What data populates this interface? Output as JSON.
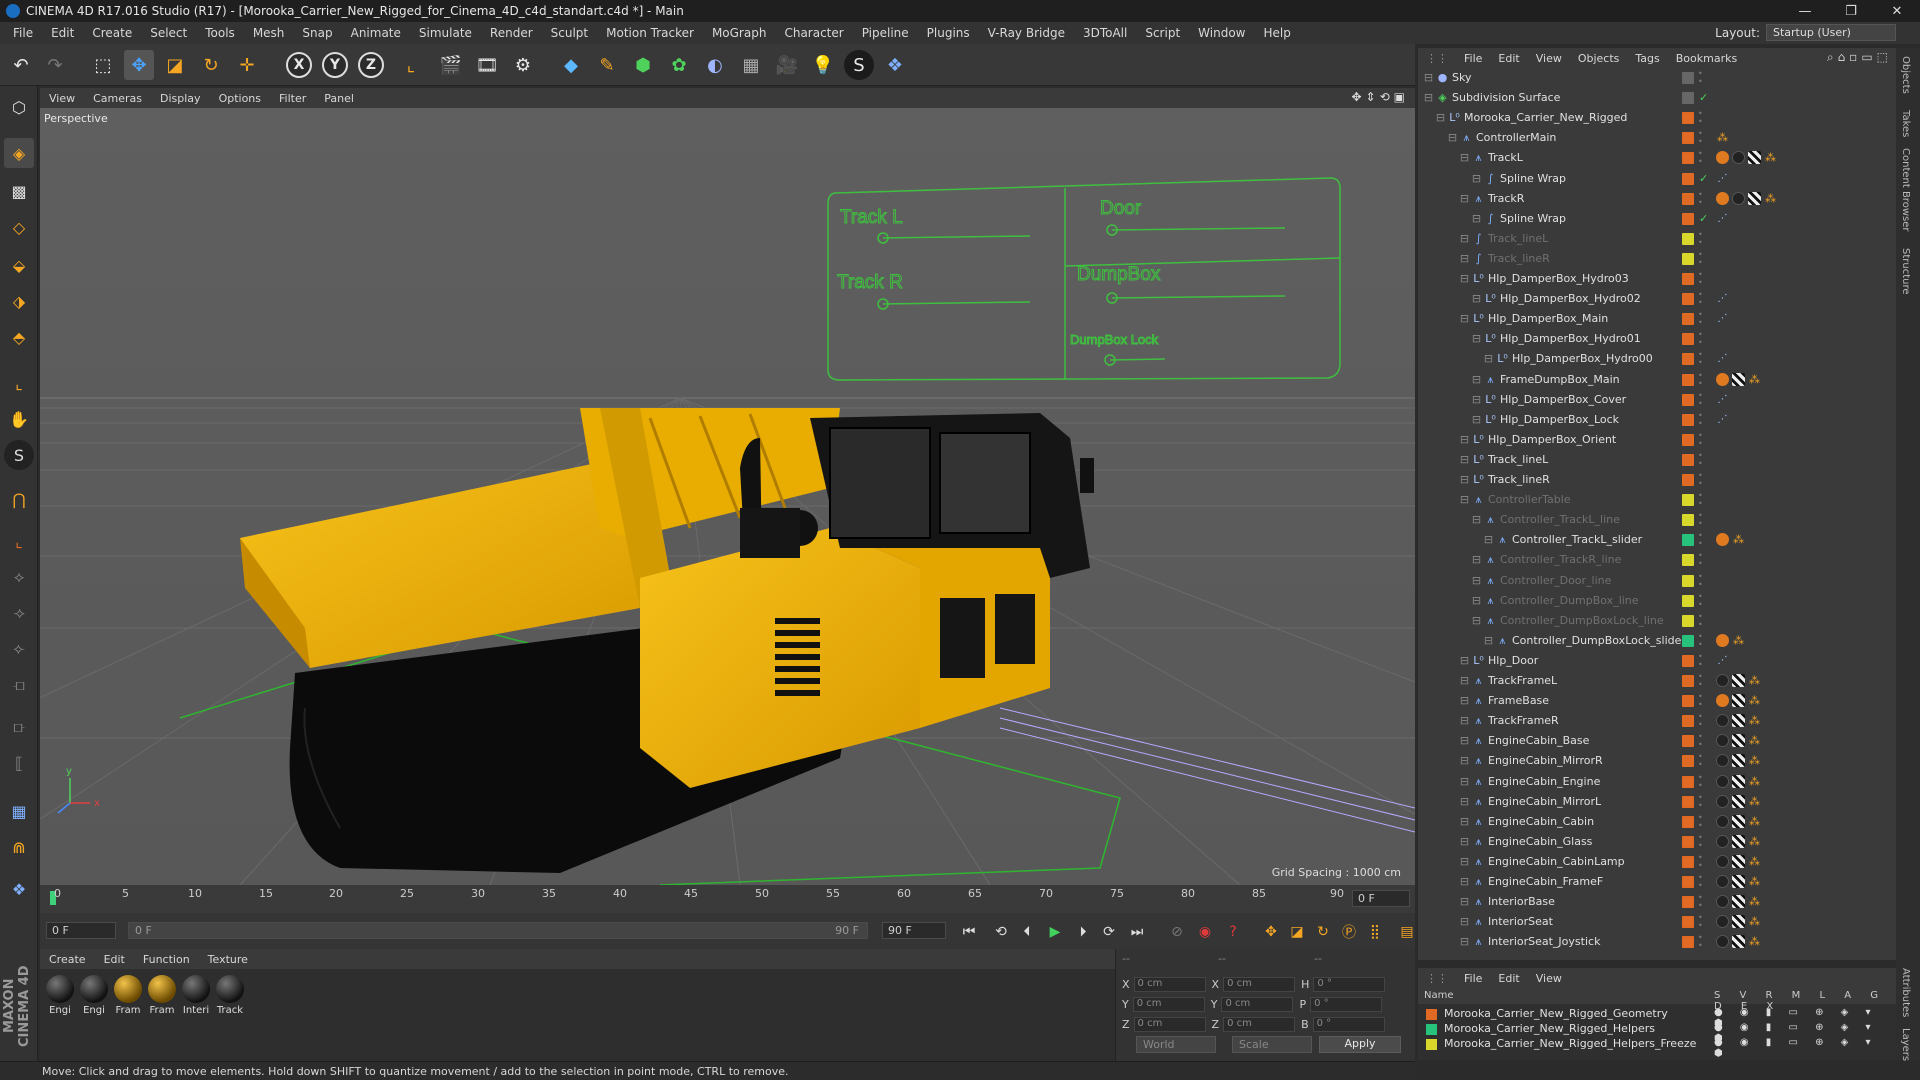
{
  "window": {
    "title": "CINEMA 4D R17.016 Studio (R17) - [Morooka_Carrier_New_Rigged_for_Cinema_4D_c4d_standart.c4d *] - Main",
    "controls": [
      "—",
      "❐",
      "✕"
    ]
  },
  "menu": [
    "File",
    "Edit",
    "Create",
    "Select",
    "Tools",
    "Mesh",
    "Snap",
    "Animate",
    "Simulate",
    "Render",
    "Sculpt",
    "Motion Tracker",
    "MoGraph",
    "Character",
    "Pipeline",
    "Plugins",
    "V-Ray Bridge",
    "3DToAll",
    "Script",
    "Window",
    "Help"
  ],
  "layout": {
    "label": "Layout:",
    "value": "Startup (User)"
  },
  "viewport": {
    "menu": [
      "View",
      "Cameras",
      "Display",
      "Options",
      "Filter",
      "Panel"
    ],
    "camera_label": "Perspective",
    "grid_spacing": "Grid Spacing : 1000 cm",
    "axis_x": "x",
    "axis_y": "y",
    "controller": {
      "track_l": "Track L",
      "track_r": "Track R",
      "door": "Door",
      "dumpbox": "DumpBox",
      "dumpbox_lock": "DumpBox Lock"
    }
  },
  "timeline": {
    "ticks": [
      "0",
      "5",
      "10",
      "15",
      "20",
      "25",
      "30",
      "35",
      "40",
      "45",
      "50",
      "55",
      "60",
      "65",
      "70",
      "75",
      "80",
      "85",
      "90"
    ],
    "current_frame": "0 F",
    "start_field": "0 F",
    "range_start": "0 F",
    "range_end": "90 F",
    "end_field": "90 F"
  },
  "materials": {
    "menu": [
      "Create",
      "Edit",
      "Function",
      "Texture"
    ],
    "items": [
      {
        "label": "Engi",
        "color": "dark"
      },
      {
        "label": "Engi",
        "color": "dark"
      },
      {
        "label": "Fram",
        "color": "yellow"
      },
      {
        "label": "Fram",
        "color": "yellow"
      },
      {
        "label": "Interi",
        "color": "dark"
      },
      {
        "label": "Track",
        "color": "dark"
      }
    ]
  },
  "coords": {
    "header": [
      "--",
      "--",
      "--"
    ],
    "rows": [
      {
        "a": "X",
        "av": "0 cm",
        "b": "X",
        "bv": "0 cm",
        "c": "H",
        "cv": "0 °"
      },
      {
        "a": "Y",
        "av": "0 cm",
        "b": "Y",
        "bv": "0 cm",
        "c": "P",
        "cv": "0 °"
      },
      {
        "a": "Z",
        "av": "0 cm",
        "b": "Z",
        "bv": "0 cm",
        "c": "B",
        "cv": "0 °"
      }
    ],
    "space": "World",
    "mode": "Scale",
    "apply": "Apply"
  },
  "status": "Move: Click and drag to move elements. Hold down SHIFT to quantize movement / add to the selection in point mode, CTRL to remove.",
  "object_manager": {
    "menu": [
      "File",
      "Edit",
      "View",
      "Objects",
      "Tags",
      "Bookmarks"
    ],
    "rows": [
      {
        "name": "Sky",
        "indent": 0,
        "icon": "sky",
        "layer": "gray",
        "dim": false,
        "tags": []
      },
      {
        "name": "Subdivision Surface",
        "indent": 0,
        "icon": "subd",
        "layer": "gray",
        "dim": false,
        "tags": [],
        "check": true
      },
      {
        "name": "Morooka_Carrier_New_Rigged",
        "indent": 1,
        "icon": "null",
        "layer": "orange",
        "dim": false,
        "tags": []
      },
      {
        "name": "ControllerMain",
        "indent": 2,
        "icon": "joint",
        "layer": "orange",
        "dim": false,
        "tags": [
          "c"
        ]
      },
      {
        "name": "TrackL",
        "indent": 3,
        "icon": "joint",
        "layer": "orange",
        "dim": false,
        "tags": [
          "e",
          "a",
          "b",
          "c"
        ]
      },
      {
        "name": "Spline Wrap",
        "indent": 4,
        "icon": "deform",
        "layer": "orange",
        "dim": false,
        "tags": [
          "d"
        ],
        "check": true
      },
      {
        "name": "TrackR",
        "indent": 3,
        "icon": "joint",
        "layer": "orange",
        "dim": false,
        "tags": [
          "e",
          "a",
          "b",
          "c"
        ]
      },
      {
        "name": "Spline Wrap",
        "indent": 4,
        "icon": "deform",
        "layer": "orange",
        "dim": false,
        "tags": [
          "d"
        ],
        "check": true
      },
      {
        "name": "Track_lineL",
        "indent": 3,
        "icon": "spline",
        "layer": "yellow",
        "dim": true,
        "tags": []
      },
      {
        "name": "Track_lineR",
        "indent": 3,
        "icon": "spline",
        "layer": "yellow",
        "dim": true,
        "tags": []
      },
      {
        "name": "Hlp_DamperBox_Hydro03",
        "indent": 3,
        "icon": "null",
        "layer": "orange",
        "dim": false,
        "tags": []
      },
      {
        "name": "Hlp_DamperBox_Hydro02",
        "indent": 4,
        "icon": "null",
        "layer": "orange",
        "dim": false,
        "tags": [
          "d"
        ]
      },
      {
        "name": "Hlp_DamperBox_Main",
        "indent": 3,
        "icon": "null",
        "layer": "orange",
        "dim": false,
        "tags": [
          "d"
        ]
      },
      {
        "name": "Hlp_DamperBox_Hydro01",
        "indent": 4,
        "icon": "null",
        "layer": "orange",
        "dim": false,
        "tags": []
      },
      {
        "name": "Hlp_DamperBox_Hydro00",
        "indent": 5,
        "icon": "null",
        "layer": "orange",
        "dim": false,
        "tags": [
          "d"
        ]
      },
      {
        "name": "FrameDumpBox_Main",
        "indent": 4,
        "icon": "joint",
        "layer": "orange",
        "dim": false,
        "tags": [
          "e",
          "b",
          "c"
        ]
      },
      {
        "name": "Hlp_DamperBox_Cover",
        "indent": 4,
        "icon": "null",
        "layer": "orange",
        "dim": false,
        "tags": [
          "d"
        ]
      },
      {
        "name": "Hlp_DamperBox_Lock",
        "indent": 4,
        "icon": "null",
        "layer": "orange",
        "dim": false,
        "tags": [
          "d"
        ]
      },
      {
        "name": "Hlp_DamperBox_Orient",
        "indent": 3,
        "icon": "null",
        "layer": "orange",
        "dim": false,
        "tags": []
      },
      {
        "name": "Track_lineL",
        "indent": 3,
        "icon": "null",
        "layer": "orange",
        "dim": false,
        "tags": []
      },
      {
        "name": "Track_lineR",
        "indent": 3,
        "icon": "null",
        "layer": "orange",
        "dim": false,
        "tags": []
      },
      {
        "name": "ControllerTable",
        "indent": 3,
        "icon": "joint",
        "layer": "yellow",
        "dim": true,
        "tags": []
      },
      {
        "name": "Controller_TrackL_line",
        "indent": 4,
        "icon": "joint",
        "layer": "yellow",
        "dim": true,
        "tags": []
      },
      {
        "name": "Controller_TrackL_slider",
        "indent": 5,
        "icon": "joint",
        "layer": "green",
        "dim": false,
        "tags": [
          "e",
          "c"
        ]
      },
      {
        "name": "Controller_TrackR_line",
        "indent": 4,
        "icon": "joint",
        "layer": "yellow",
        "dim": true,
        "tags": []
      },
      {
        "name": "Controller_Door_line",
        "indent": 4,
        "icon": "joint",
        "layer": "yellow",
        "dim": true,
        "tags": []
      },
      {
        "name": "Controller_DumpBox_line",
        "indent": 4,
        "icon": "joint",
        "layer": "yellow",
        "dim": true,
        "tags": []
      },
      {
        "name": "Controller_DumpBoxLock_line",
        "indent": 4,
        "icon": "joint",
        "layer": "yellow",
        "dim": true,
        "tags": []
      },
      {
        "name": "Controller_DumpBoxLock_slider",
        "indent": 5,
        "icon": "joint",
        "layer": "green",
        "dim": false,
        "tags": [
          "e",
          "c"
        ]
      },
      {
        "name": "Hlp_Door",
        "indent": 3,
        "icon": "null",
        "layer": "orange",
        "dim": false,
        "tags": [
          "d"
        ]
      },
      {
        "name": "TrackFrameL",
        "indent": 3,
        "icon": "joint",
        "layer": "orange",
        "dim": false,
        "tags": [
          "a",
          "b",
          "c"
        ]
      },
      {
        "name": "FrameBase",
        "indent": 3,
        "icon": "joint",
        "layer": "orange",
        "dim": false,
        "tags": [
          "e",
          "b",
          "c"
        ]
      },
      {
        "name": "TrackFrameR",
        "indent": 3,
        "icon": "joint",
        "layer": "orange",
        "dim": false,
        "tags": [
          "a",
          "b",
          "c"
        ]
      },
      {
        "name": "EngineCabin_Base",
        "indent": 3,
        "icon": "joint",
        "layer": "orange",
        "dim": false,
        "tags": [
          "a",
          "b",
          "c"
        ]
      },
      {
        "name": "EngineCabin_MirrorR",
        "indent": 3,
        "icon": "joint",
        "layer": "orange",
        "dim": false,
        "tags": [
          "a",
          "b",
          "c"
        ]
      },
      {
        "name": "EngineCabin_Engine",
        "indent": 3,
        "icon": "joint",
        "layer": "orange",
        "dim": false,
        "tags": [
          "a",
          "b",
          "c"
        ]
      },
      {
        "name": "EngineCabin_MirrorL",
        "indent": 3,
        "icon": "joint",
        "layer": "orange",
        "dim": false,
        "tags": [
          "a",
          "b",
          "c"
        ]
      },
      {
        "name": "EngineCabin_Cabin",
        "indent": 3,
        "icon": "joint",
        "layer": "orange",
        "dim": false,
        "tags": [
          "a",
          "b",
          "c"
        ]
      },
      {
        "name": "EngineCabin_Glass",
        "indent": 3,
        "icon": "joint",
        "layer": "orange",
        "dim": false,
        "tags": [
          "a",
          "b",
          "c"
        ]
      },
      {
        "name": "EngineCabin_CabinLamp",
        "indent": 3,
        "icon": "joint",
        "layer": "orange",
        "dim": false,
        "tags": [
          "a",
          "b",
          "c"
        ]
      },
      {
        "name": "EngineCabin_FrameF",
        "indent": 3,
        "icon": "joint",
        "layer": "orange",
        "dim": false,
        "tags": [
          "a",
          "b",
          "c"
        ]
      },
      {
        "name": "InteriorBase",
        "indent": 3,
        "icon": "joint",
        "layer": "orange",
        "dim": false,
        "tags": [
          "a",
          "b",
          "c"
        ]
      },
      {
        "name": "InteriorSeat",
        "indent": 3,
        "icon": "joint",
        "layer": "orange",
        "dim": false,
        "tags": [
          "a",
          "b",
          "c"
        ]
      },
      {
        "name": "InteriorSeat_Joystick",
        "indent": 3,
        "icon": "joint",
        "layer": "orange",
        "dim": false,
        "tags": [
          "a",
          "b",
          "c"
        ]
      }
    ]
  },
  "side_tabs": [
    "Objects",
    "Takes",
    "Content Browser",
    "Structure"
  ],
  "side_tabs_bottom": [
    "Attributes",
    "Layers"
  ],
  "layer_manager": {
    "menu": [
      "File",
      "Edit",
      "View"
    ],
    "header_name": "Name",
    "header_cols": "S V R M L A G D E X",
    "rows": [
      {
        "name": "Morooka_Carrier_New_Rigged_Geometry",
        "color": "#e06a24"
      },
      {
        "name": "Morooka_Carrier_New_Rigged_Helpers",
        "color": "#27c27c"
      },
      {
        "name": "Morooka_Carrier_New_Rigged_Helpers_Freeze",
        "color": "#d8d82c"
      }
    ]
  },
  "brand": "MAXON CINEMA 4D",
  "colors": {
    "controller_green": "#3fbf3f",
    "truck_yellow": "#f0b400",
    "play_green": "#42d15c"
  }
}
